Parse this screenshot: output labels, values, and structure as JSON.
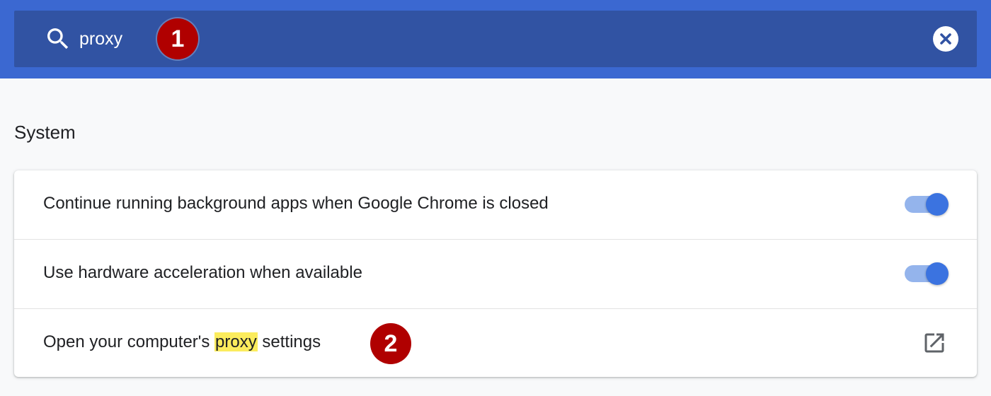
{
  "search": {
    "value": "proxy",
    "icon": "search-icon",
    "clear_icon": "close-circle-icon"
  },
  "callouts": [
    "1",
    "2"
  ],
  "section": {
    "title": "System"
  },
  "settings": [
    {
      "label": "Continue running background apps when Google Chrome is closed",
      "control": "toggle",
      "state": "on"
    },
    {
      "label": "Use hardware acceleration when available",
      "control": "toggle",
      "state": "on"
    },
    {
      "label_before": "Open your computer's ",
      "label_highlight": "proxy",
      "label_after": " settings",
      "control": "external-link-icon"
    }
  ],
  "colors": {
    "topbar": "#3b68d1",
    "searchbox": "#3153a3",
    "toggle_on": "#3b73e0",
    "highlight": "#fbec5d",
    "callout": "#b00000"
  }
}
